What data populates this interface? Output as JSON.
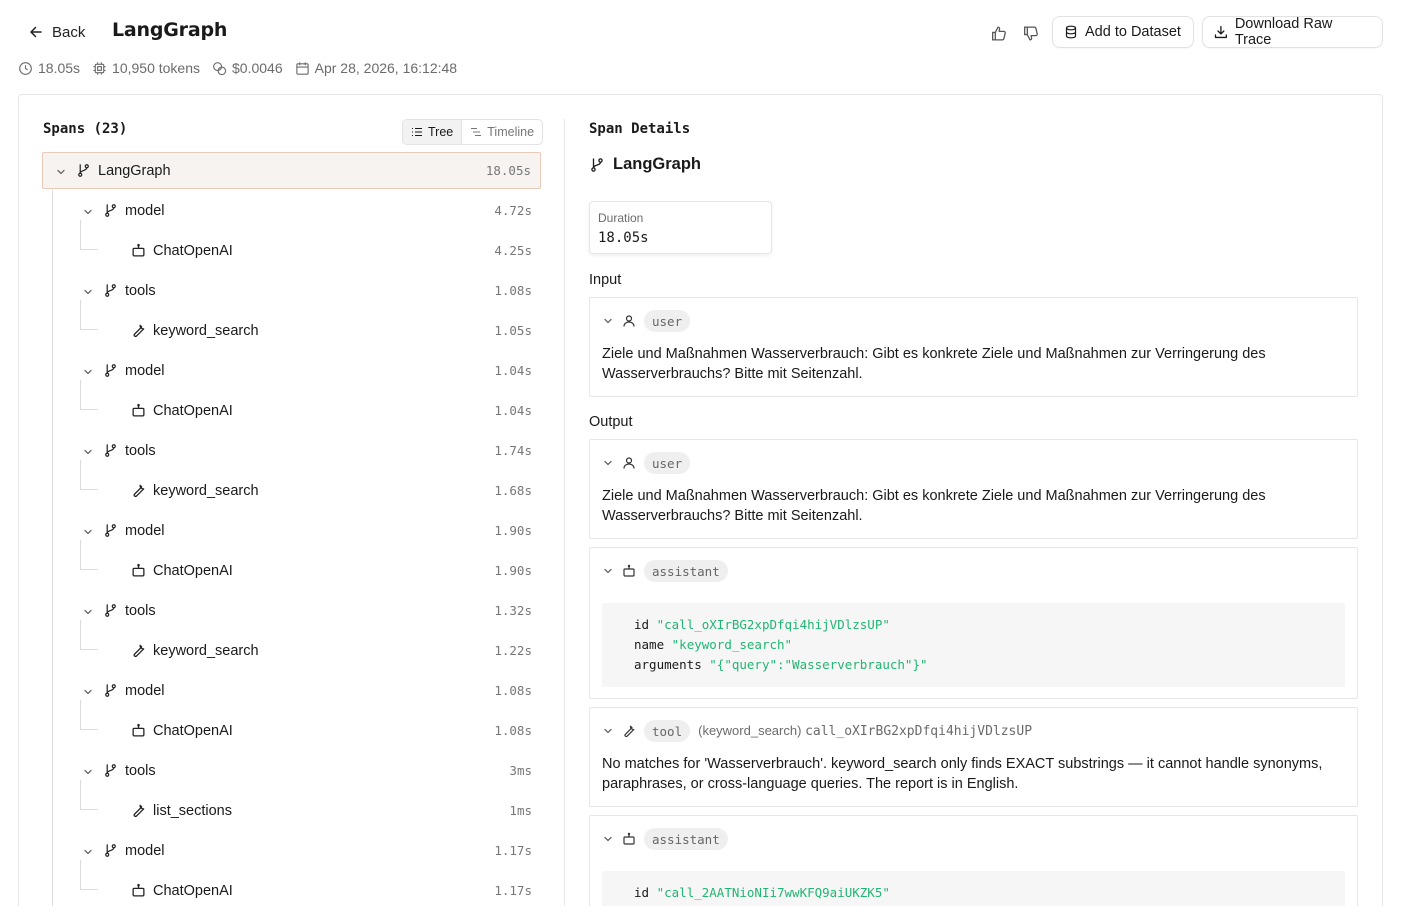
{
  "header": {
    "back_label": "Back",
    "title": "LangGraph",
    "add_dataset_label": "Add to Dataset",
    "download_label": "Download Raw Trace"
  },
  "meta": {
    "duration": "18.05s",
    "tokens": "10,950 tokens",
    "cost": "$0.0046",
    "timestamp": "Apr 28, 2026, 16:12:48"
  },
  "spans": {
    "title": "Spans (23)",
    "view_tree": "Tree",
    "view_timeline": "Timeline",
    "rows": [
      {
        "label": "LangGraph",
        "duration": "18.05s",
        "kind": "graph",
        "depth": 0,
        "selected": true
      },
      {
        "label": "model",
        "duration": "4.72s",
        "kind": "graph",
        "depth": 1
      },
      {
        "label": "ChatOpenAI",
        "duration": "4.25s",
        "kind": "llm",
        "depth": 2
      },
      {
        "label": "tools",
        "duration": "1.08s",
        "kind": "graph",
        "depth": 1
      },
      {
        "label": "keyword_search",
        "duration": "1.05s",
        "kind": "tool",
        "depth": 2
      },
      {
        "label": "model",
        "duration": "1.04s",
        "kind": "graph",
        "depth": 1
      },
      {
        "label": "ChatOpenAI",
        "duration": "1.04s",
        "kind": "llm",
        "depth": 2
      },
      {
        "label": "tools",
        "duration": "1.74s",
        "kind": "graph",
        "depth": 1
      },
      {
        "label": "keyword_search",
        "duration": "1.68s",
        "kind": "tool",
        "depth": 2
      },
      {
        "label": "model",
        "duration": "1.90s",
        "kind": "graph",
        "depth": 1
      },
      {
        "label": "ChatOpenAI",
        "duration": "1.90s",
        "kind": "llm",
        "depth": 2
      },
      {
        "label": "tools",
        "duration": "1.32s",
        "kind": "graph",
        "depth": 1
      },
      {
        "label": "keyword_search",
        "duration": "1.22s",
        "kind": "tool",
        "depth": 2
      },
      {
        "label": "model",
        "duration": "1.08s",
        "kind": "graph",
        "depth": 1
      },
      {
        "label": "ChatOpenAI",
        "duration": "1.08s",
        "kind": "llm",
        "depth": 2
      },
      {
        "label": "tools",
        "duration": "3ms",
        "kind": "graph",
        "depth": 1
      },
      {
        "label": "list_sections",
        "duration": "1ms",
        "kind": "tool",
        "depth": 2
      },
      {
        "label": "model",
        "duration": "1.17s",
        "kind": "graph",
        "depth": 1
      },
      {
        "label": "ChatOpenAI",
        "duration": "1.17s",
        "kind": "llm",
        "depth": 2
      }
    ]
  },
  "details": {
    "title": "Span Details",
    "name": "LangGraph",
    "duration_label": "Duration",
    "duration_value": "18.05s",
    "input_label": "Input",
    "output_label": "Output",
    "input_msg": {
      "role": "user",
      "text": "Ziele und Maßnahmen Wasserverbrauch: Gibt es konkrete Ziele und Maßnahmen zur Verringerung des Wasserverbrauchs? Bitte mit Seitenzahl."
    },
    "output_user": {
      "role": "user",
      "text": "Ziele und Maßnahmen Wasserverbrauch: Gibt es konkrete Ziele und Maßnahmen zur Verringerung des Wasserverbrauchs? Bitte mit Seitenzahl."
    },
    "output_assistant_1": {
      "role": "assistant",
      "id_key": "id",
      "id_val": "\"call_oXIrBG2xpDfqi4hijVDlzsUP\"",
      "name_key": "name",
      "name_val": "\"keyword_search\"",
      "args_key": "arguments",
      "args_val": "\"{\"query\":\"Wasserverbrauch\"}\""
    },
    "output_tool": {
      "role": "tool",
      "tool_name": "(keyword_search)",
      "call_id": "call_oXIrBG2xpDfqi4hijVDlzsUP",
      "text": "No matches for 'Wasserverbrauch'. keyword_search only finds EXACT substrings — it cannot handle synonyms, paraphrases, or cross-language queries. The report is in English."
    },
    "output_assistant_2": {
      "role": "assistant",
      "id_key": "id",
      "id_val": "\"call_2AATNioNIi7wwKFQ9aiUKZK5\""
    }
  },
  "colors": {
    "selected_bg": "#f7f3f1",
    "selected_border": "#ebc9b9",
    "string_green": "#22b573"
  }
}
